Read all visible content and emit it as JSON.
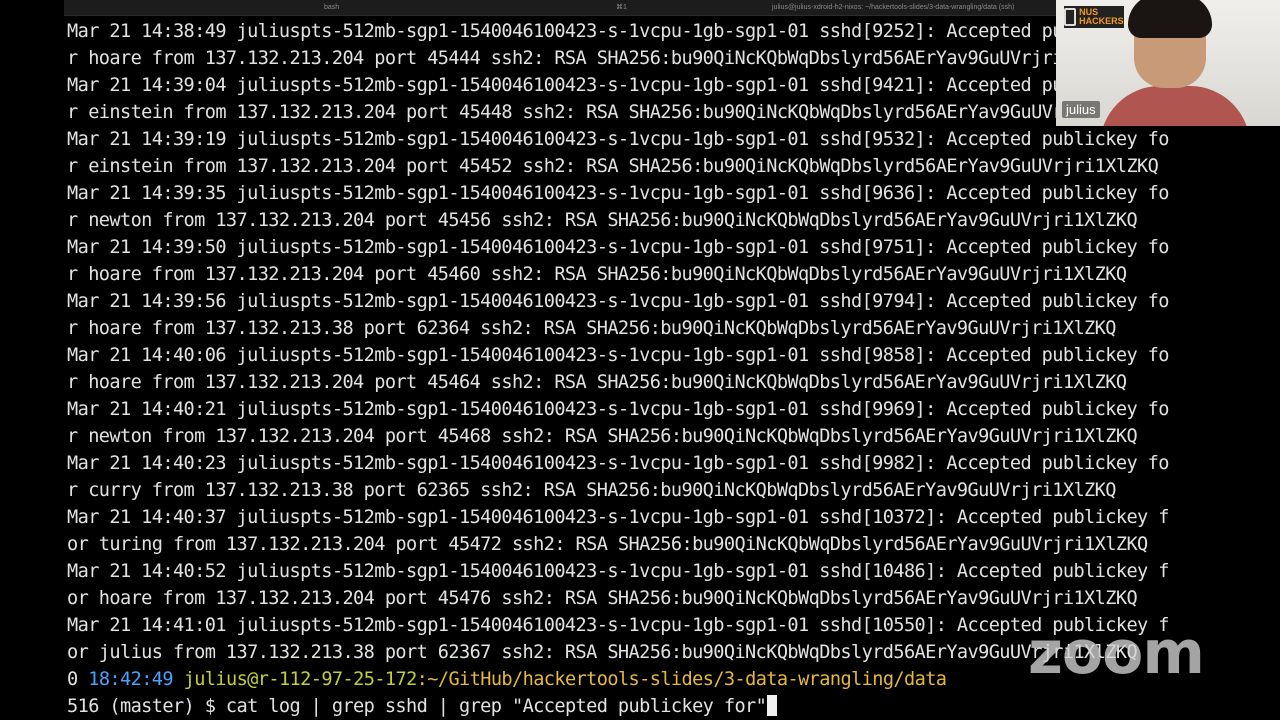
{
  "window": {
    "tab_left": "bash",
    "tab_mid": "⌘1",
    "tab_right": "julius@julius-xdroid-h2-nixos: ~/hackertools-slides/3-data-wrangling/data (ssh)"
  },
  "terminal": {
    "lines": [
      "Mar 21 14:38:49 juliuspts-512mb-sgp1-1540046100423-s-1vcpu-1gb-sgp1-01 sshd[9252]: Accepted publickey fo",
      "r hoare from 137.132.213.204 port 45444 ssh2: RSA SHA256:bu90QiNcKQbWqDbslyrd56AErYav9GuUVrjri1XlZKQ",
      "Mar 21 14:39:04 juliuspts-512mb-sgp1-1540046100423-s-1vcpu-1gb-sgp1-01 sshd[9421]: Accepted publickey fo",
      "r einstein from 137.132.213.204 port 45448 ssh2: RSA SHA256:bu90QiNcKQbWqDbslyrd56AErYav9GuUVrjri1XlZKQ",
      "Mar 21 14:39:19 juliuspts-512mb-sgp1-1540046100423-s-1vcpu-1gb-sgp1-01 sshd[9532]: Accepted publickey fo",
      "r einstein from 137.132.213.204 port 45452 ssh2: RSA SHA256:bu90QiNcKQbWqDbslyrd56AErYav9GuUVrjri1XlZKQ",
      "Mar 21 14:39:35 juliuspts-512mb-sgp1-1540046100423-s-1vcpu-1gb-sgp1-01 sshd[9636]: Accepted publickey fo",
      "r newton from 137.132.213.204 port 45456 ssh2: RSA SHA256:bu90QiNcKQbWqDbslyrd56AErYav9GuUVrjri1XlZKQ",
      "Mar 21 14:39:50 juliuspts-512mb-sgp1-1540046100423-s-1vcpu-1gb-sgp1-01 sshd[9751]: Accepted publickey fo",
      "r hoare from 137.132.213.204 port 45460 ssh2: RSA SHA256:bu90QiNcKQbWqDbslyrd56AErYav9GuUVrjri1XlZKQ",
      "Mar 21 14:39:56 juliuspts-512mb-sgp1-1540046100423-s-1vcpu-1gb-sgp1-01 sshd[9794]: Accepted publickey fo",
      "r hoare from 137.132.213.38 port 62364 ssh2: RSA SHA256:bu90QiNcKQbWqDbslyrd56AErYav9GuUVrjri1XlZKQ",
      "Mar 21 14:40:06 juliuspts-512mb-sgp1-1540046100423-s-1vcpu-1gb-sgp1-01 sshd[9858]: Accepted publickey fo",
      "r hoare from 137.132.213.204 port 45464 ssh2: RSA SHA256:bu90QiNcKQbWqDbslyrd56AErYav9GuUVrjri1XlZKQ",
      "Mar 21 14:40:21 juliuspts-512mb-sgp1-1540046100423-s-1vcpu-1gb-sgp1-01 sshd[9969]: Accepted publickey fo",
      "r newton from 137.132.213.204 port 45468 ssh2: RSA SHA256:bu90QiNcKQbWqDbslyrd56AErYav9GuUVrjri1XlZKQ",
      "Mar 21 14:40:23 juliuspts-512mb-sgp1-1540046100423-s-1vcpu-1gb-sgp1-01 sshd[9982]: Accepted publickey fo",
      "r curry from 137.132.213.38 port 62365 ssh2: RSA SHA256:bu90QiNcKQbWqDbslyrd56AErYav9GuUVrjri1XlZKQ",
      "Mar 21 14:40:37 juliuspts-512mb-sgp1-1540046100423-s-1vcpu-1gb-sgp1-01 sshd[10372]: Accepted publickey f",
      "or turing from 137.132.213.204 port 45472 ssh2: RSA SHA256:bu90QiNcKQbWqDbslyrd56AErYav9GuUVrjri1XlZKQ",
      "Mar 21 14:40:52 juliuspts-512mb-sgp1-1540046100423-s-1vcpu-1gb-sgp1-01 sshd[10486]: Accepted publickey f",
      "or hoare from 137.132.213.204 port 45476 ssh2: RSA SHA256:bu90QiNcKQbWqDbslyrd56AErYav9GuUVrjri1XlZKQ",
      "Mar 21 14:41:01 juliuspts-512mb-sgp1-1540046100423-s-1vcpu-1gb-sgp1-01 sshd[10550]: Accepted publickey f",
      "or julius from 137.132.213.38 port 62367 ssh2: RSA SHA256:bu90QiNcKQbWqDbslyrd56AErYav9GuUVrjri1XlZKQ"
    ],
    "prompt": {
      "status": "0",
      "time": "18:42:49",
      "user_host": "julius@r-112-97-25-172",
      "path": ":~/GitHub/hackertools-slides/3-data-wrangling/data",
      "history_and_branch": "516 (master) $ ",
      "command": "cat log | grep sshd | grep \"Accepted publickey for\""
    }
  },
  "webcam": {
    "logo_text": "NUS HACKERS",
    "participant_name": "julius"
  },
  "watermark": {
    "text": "zoom"
  },
  "colors": {
    "background": "#000000",
    "text": "#e2e2e2",
    "prompt_time": "#4aa3ff",
    "prompt_user": "#c4cf35",
    "prompt_path": "#e5b93c"
  }
}
